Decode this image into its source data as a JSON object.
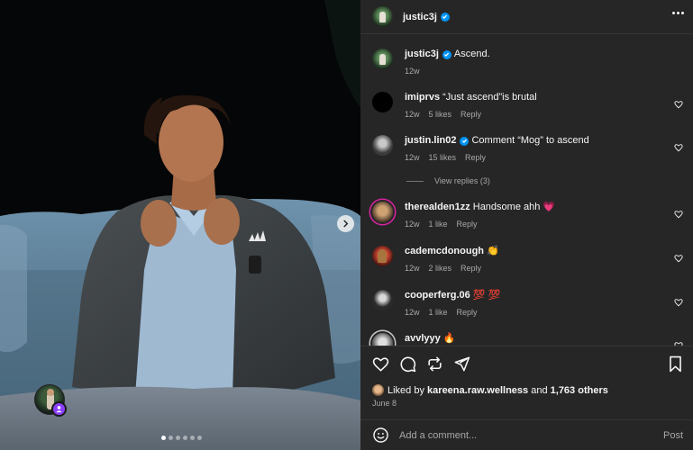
{
  "post": {
    "author": "justic3j",
    "caption": "Ascend.",
    "caption_age": "12w"
  },
  "comments": [
    {
      "user": "imiprvs",
      "text": "“Just ascend”is brutal",
      "age": "12w",
      "likes": "5 likes",
      "reply": "Reply"
    },
    {
      "user": "justin.lin02",
      "text": "Comment “Mog” to ascend",
      "age": "12w",
      "likes": "15 likes",
      "reply": "Reply",
      "verified": true
    },
    {
      "user": "therealden1zz",
      "text": "Handsome ahh 💗",
      "age": "12w",
      "likes": "1 like",
      "reply": "Reply"
    },
    {
      "user": "cademcdonough",
      "text": "👏",
      "age": "12w",
      "likes": "2 likes",
      "reply": "Reply"
    },
    {
      "user": "cooperferg.06",
      "text": "💯 💯",
      "age": "12w",
      "likes": "1 like",
      "reply": "Reply"
    },
    {
      "user": "avvlyyy",
      "text": "🔥",
      "age": "",
      "likes": "",
      "reply": ""
    }
  ],
  "view_replies": "View replies (3)",
  "liked_by": {
    "prefix": "Liked by",
    "user": "kareena.raw.wellness",
    "and": "and",
    "others": "1,763 others"
  },
  "post_date": "June 8",
  "composer": {
    "placeholder": "Add a comment...",
    "post_label": "Post"
  },
  "carousel": {
    "total_slides": 6,
    "active_slide": 1
  },
  "colors": {
    "panel_bg": "#262626",
    "verified": "#0095f6",
    "secondary_text": "#a8a8a8"
  }
}
